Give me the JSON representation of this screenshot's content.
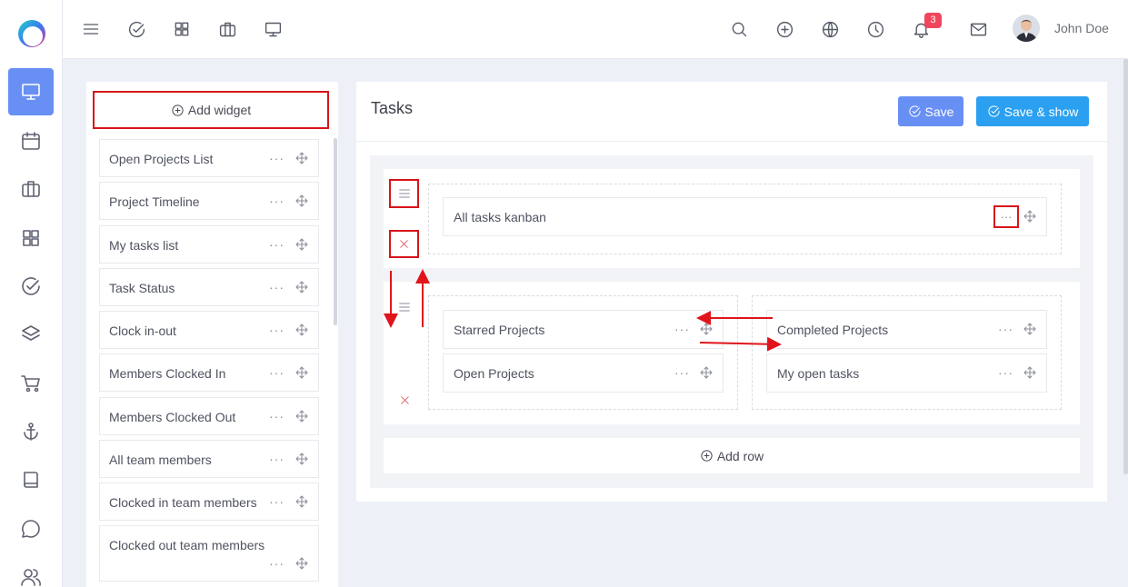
{
  "topbar": {
    "notifications_count": "3",
    "user_name": "John Doe",
    "icons": [
      "menu-icon",
      "check-circle-icon",
      "grid-icon",
      "briefcase-icon",
      "monitor-icon",
      "search-icon",
      "plus-circle-icon",
      "globe-icon",
      "clock-icon",
      "bell-icon",
      "mail-icon"
    ]
  },
  "sidebar": {
    "items": [
      "monitor-icon",
      "calendar-icon",
      "briefcase-icon",
      "grid-icon",
      "check-circle-icon",
      "layers-icon",
      "cart-icon",
      "anchor-icon",
      "book-icon",
      "chat-icon",
      "users-icon"
    ],
    "active_index": 0
  },
  "widgets": {
    "add_label": "Add widget",
    "items": [
      {
        "label": "Open Projects List"
      },
      {
        "label": "Project Timeline"
      },
      {
        "label": "My tasks list"
      },
      {
        "label": "Task Status"
      },
      {
        "label": "Clock in-out"
      },
      {
        "label": "Members Clocked In"
      },
      {
        "label": "Members Clocked Out"
      },
      {
        "label": "All team members"
      },
      {
        "label": "Clocked in team members"
      },
      {
        "label": "Clocked out team members"
      }
    ]
  },
  "main": {
    "title": "Tasks",
    "save_label": "Save",
    "save_show_label": "Save & show",
    "add_row_label": "Add row",
    "rows": [
      {
        "columns": [
          [
            "All tasks kanban"
          ]
        ]
      },
      {
        "columns": [
          [
            "Starred Projects",
            "Open Projects"
          ],
          [
            "Completed Projects",
            "My open tasks"
          ]
        ]
      }
    ]
  },
  "colors": {
    "primary": "#6890f4",
    "accent": "#2ba0f0",
    "highlight": "#d8141b",
    "danger": "#e05a5a"
  }
}
